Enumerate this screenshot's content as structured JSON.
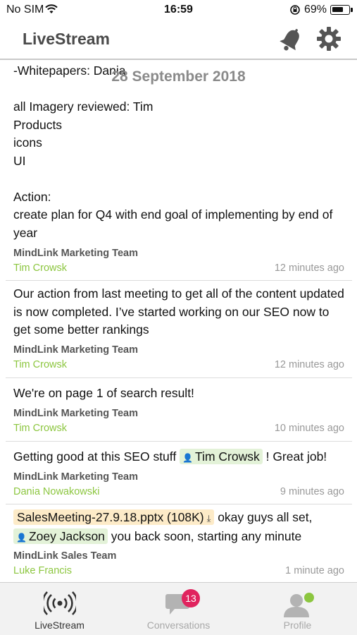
{
  "status_bar": {
    "carrier": "No SIM",
    "time": "16:59",
    "battery_pct": "69%"
  },
  "header": {
    "title": "LiveStream"
  },
  "feed": {
    "date_separator": "28 September 2018",
    "messages": [
      {
        "body": "-Whitepapers: Dania\n\nall Imagery reviewed: Tim\nProducts\nicons\nUI\n\nAction:\ncreate plan for Q4 with end goal of implementing by end of year",
        "team": "MindLink Marketing Team",
        "sender": "Tim Crowsk",
        "time": "12 minutes ago"
      },
      {
        "body": "Our action from last meeting to get all of the content updated is now completed. I’ve started working on our SEO now to get some better rankings",
        "team": "MindLink Marketing Team",
        "sender": "Tim Crowsk",
        "time": "12 minutes ago"
      },
      {
        "body": "We're on page 1 of search result!",
        "team": "MindLink Marketing Team",
        "sender": "Tim Crowsk",
        "time": "10 minutes ago"
      },
      {
        "body_prefix": "Getting good at this SEO stuff ",
        "mention": "Tim Crowsk",
        "body_suffix": " ! Great job!",
        "team": "MindLink Marketing Team",
        "sender": "Dania Nowakowski",
        "time": "9 minutes ago"
      },
      {
        "file": "SalesMeeting-27.9.18.pptx (108K)",
        "body_after_file": " okay guys all set,",
        "mention": "Zoey Jackson",
        "body_suffix": " you back soon, starting any minute",
        "team": "MindLink Sales Team",
        "sender": "Luke Francis",
        "time": "1 minute ago"
      }
    ]
  },
  "tabs": [
    {
      "label": "LiveStream",
      "icon": "broadcast-icon",
      "active": true
    },
    {
      "label": "Conversations",
      "icon": "chat-bubble-icon",
      "badge": "13",
      "active": false
    },
    {
      "label": "Profile",
      "icon": "profile-icon",
      "active": false
    }
  ],
  "colors": {
    "sender_green": "#8cc63f",
    "badge_red": "#e0245e",
    "mention_bg": "#e3f2d8",
    "file_bg": "#fdebc8"
  }
}
